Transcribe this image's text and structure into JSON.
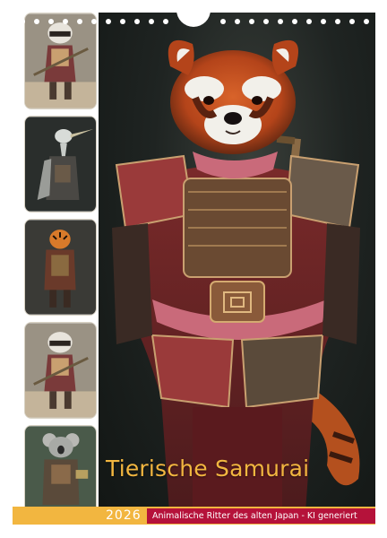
{
  "calendar": {
    "title": "Tierische Samurai",
    "year": "2026",
    "subtitle": "Animalische Ritter des alten Japan - KI generiert"
  },
  "hero_image": {
    "subject": "red-panda-samurai"
  },
  "thumbnails": [
    {
      "subject": "raccoon-samurai"
    },
    {
      "subject": "heron-samurai"
    },
    {
      "subject": "tiger-samurai"
    },
    {
      "subject": "raccoon-samurai"
    },
    {
      "subject": "koala-samurai"
    }
  ],
  "colors": {
    "accent_yellow": "#f2b640",
    "subtitle_red": "#b5123a",
    "background": "#ffffff"
  }
}
